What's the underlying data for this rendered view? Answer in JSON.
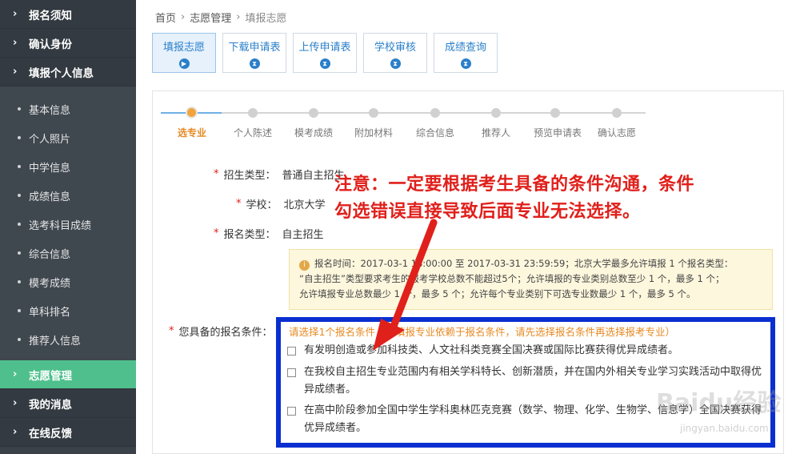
{
  "sidebar": {
    "top_items": [
      {
        "label": "报名须知"
      },
      {
        "label": "确认身份"
      },
      {
        "label": "填报个人信息"
      }
    ],
    "sub_items": [
      {
        "label": "基本信息"
      },
      {
        "label": "个人照片"
      },
      {
        "label": "中学信息"
      },
      {
        "label": "成绩信息"
      },
      {
        "label": "选考科目成绩"
      },
      {
        "label": "综合信息"
      },
      {
        "label": "模考成绩"
      },
      {
        "label": "单科排名"
      },
      {
        "label": "推荐人信息"
      }
    ],
    "bottom_items": [
      {
        "label": "志愿管理",
        "active": true
      },
      {
        "label": "我的消息"
      },
      {
        "label": "在线反馈"
      }
    ],
    "active_color": "#4fc08d"
  },
  "breadcrumb": {
    "home": "首页",
    "section": "志愿管理",
    "current": "填报志愿",
    "separator": "›"
  },
  "tabs": [
    {
      "label": "填报志愿",
      "active": true
    },
    {
      "label": "下载申请表"
    },
    {
      "label": "上传申请表"
    },
    {
      "label": "学校审核"
    },
    {
      "label": "成绩查询"
    }
  ],
  "steps": [
    {
      "label": "选专业",
      "active": true
    },
    {
      "label": "个人陈述"
    },
    {
      "label": "模考成绩"
    },
    {
      "label": "附加材料"
    },
    {
      "label": "综合信息"
    },
    {
      "label": "推荐人"
    },
    {
      "label": "预览申请表"
    },
    {
      "label": "确认志愿"
    }
  ],
  "form": {
    "recruit_type_label": "招生类型：",
    "recruit_type_value": "普通自主招生",
    "school_label": "学校：",
    "school_value": "北京大学",
    "apply_type_label": "报名类型：",
    "apply_type_value": "自主招生",
    "required_mark": "*"
  },
  "notice": {
    "icon": "i",
    "line1": "报名时间：2017-03-1 18:00:00 至 2017-03-31 23:59:59；北京大学最多允许填报 1 个报名类型：",
    "line2": "“自主招生”类型要求考生的报考学校总数不能超过5个；允许填报的专业类别总数至少 1 个，最多 1 个；",
    "line3": "允许填报专业总数最少 1 个，最多 5 个；允许每个专业类别下可选专业数最少 1 个，最多 5 个。"
  },
  "conditions": {
    "label": "您具备的报名条件：",
    "hint": "请选择1个报名条件（可填报专业依赖于报名条件，请先选择报名条件再选择报考专业）",
    "items": [
      {
        "text": "有发明创造或参加科技类、人文社科类竞赛全国决赛或国际比赛获得优异成绩者。"
      },
      {
        "text": "在我校自主招生专业范围内有相关学科特长、创新潜质，并在国内外相关专业学习实践活动中取得优异成绩者。"
      },
      {
        "text": "在高中阶段参加全国中学生学科奥林匹克竞赛（数学、物理、化学、生物学、信息学）全国决赛获得优异成绩者。"
      }
    ]
  },
  "annotation": {
    "line1": "注意：一定要根据考生具备的条件沟通，条件",
    "line2": "勾选错误直接导致后面专业无法选择。",
    "color": "#e0201b"
  },
  "highlight_color": "#0a2fd0",
  "watermark": {
    "text": "Baidu经验",
    "sub": "jingyan.baidu.com"
  }
}
